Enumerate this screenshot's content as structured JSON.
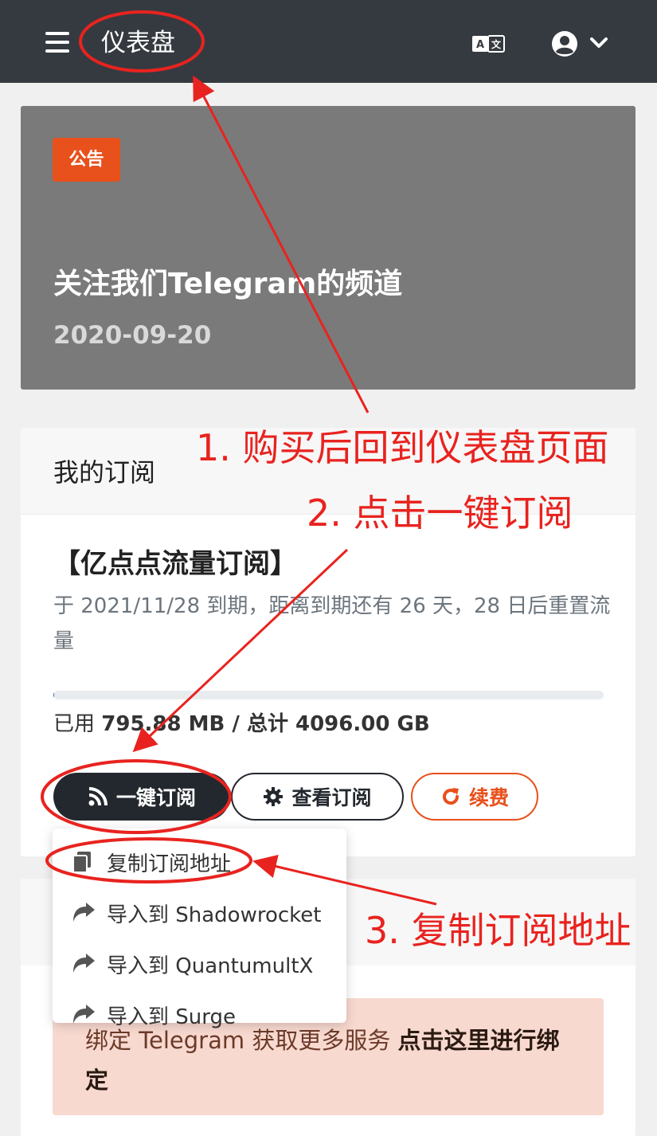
{
  "nav": {
    "title": "仪表盘",
    "menu_icon": "hamburger-icon",
    "language_icon": "translate-icon",
    "user_icon": "user-circle-icon",
    "dropdown_icon": "chevron-down-icon"
  },
  "announcement": {
    "badge": "公告",
    "title": "关注我们Telegram的频道",
    "date": "2020-09-20"
  },
  "subscription": {
    "header": "我的订阅",
    "plan_name": "【亿点点流量订阅】",
    "expiry_text": "于 2021/11/28 到期，距离到期还有 26 天，28 日后重置流量",
    "usage_prefix": "已用 ",
    "used": "795.88 MB",
    "usage_sep": " / 总计 ",
    "total": "4096.00 GB",
    "progress_fraction": 0.0002,
    "buttons": {
      "subscribe": "一键订阅",
      "view": "查看订阅",
      "renew": "续费"
    }
  },
  "dropdown": {
    "items": [
      {
        "label": "复制订阅地址",
        "icon": "copy-icon"
      },
      {
        "label": "导入到 Shadowrocket",
        "icon": "share-icon"
      },
      {
        "label": "导入到 QuantumultX",
        "icon": "share-icon"
      },
      {
        "label": "导入到 Surge",
        "icon": "share-icon"
      }
    ]
  },
  "alert": {
    "text": "绑定 Telegram 获取更多服务 ",
    "link": "点击这里进行绑定"
  },
  "annotations": {
    "step1": "1. 购买后回到仪表盘页面",
    "step2": "2. 点击一键订阅",
    "step3": "3. 复制订阅地址"
  },
  "colors": {
    "navbar": "#353a40",
    "accent": "#e8501c",
    "annotation_red": "#e8231f"
  }
}
